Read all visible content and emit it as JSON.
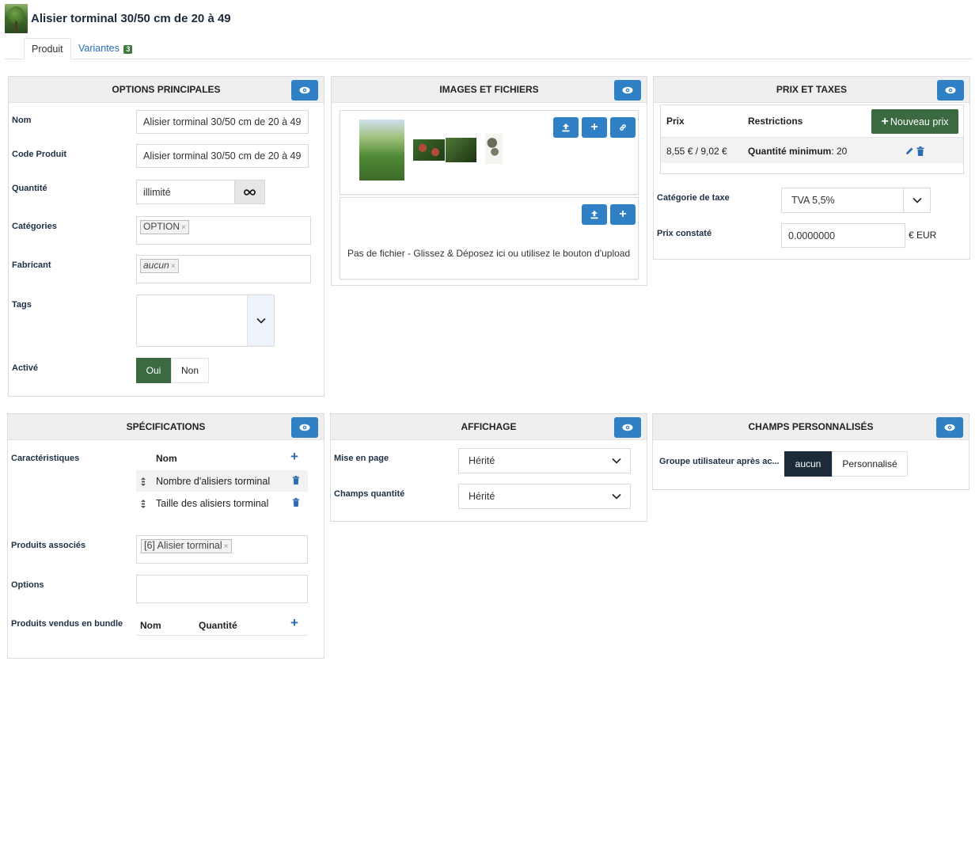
{
  "header": {
    "title": "Alisier torminal 30/50 cm de 20 à 49",
    "thumbnail_icon": "tree-thumbnail"
  },
  "tabs": [
    {
      "label": "Produit"
    },
    {
      "label": "Variantes",
      "badge": "3"
    }
  ],
  "options_principales": {
    "title": "OPTIONS PRINCIPALES",
    "nom_label": "Nom",
    "nom_value": "Alisier torminal 30/50 cm de 20 à 49",
    "code_label": "Code Produit",
    "code_value": "Alisier torminal 30/50 cm de 20 à 49",
    "quantite_label": "Quantité",
    "quantite_value": "illimité",
    "quantite_icon": "infinity-icon",
    "categories_label": "Catégories",
    "categories_tag": "OPTION",
    "fabricant_label": "Fabricant",
    "fabricant_tag": "aucun",
    "tags_label": "Tags",
    "active_label": "Activé",
    "active_on": "Oui",
    "active_off": "Non"
  },
  "images": {
    "title": "IMAGES ET FICHIERS",
    "no_file_text": "Pas de fichier - Glissez & Déposez ici ou utilisez le bouton d'upload"
  },
  "prix": {
    "title": "PRIX ET TAXES",
    "col_prix": "Prix",
    "col_restrictions": "Restrictions",
    "new_price_button": "Nouveau prix",
    "row_price": "8,55 € / 9,02 €",
    "row_restriction_label": "Quantité minimum",
    "row_restriction_value": ": 20",
    "taxe_label": "Catégorie de taxe",
    "taxe_value": "TVA 5,5%",
    "prix_constate_label": "Prix constaté",
    "prix_constate_value": "0.0000000",
    "currency": "€ EUR"
  },
  "specifications": {
    "title": "SPÉCIFICATIONS",
    "caracteristiques_label": "Caractéristiques",
    "col_nom": "Nom",
    "rows": [
      "Nombre d'alisiers torminal",
      "Taille des alisiers torminal"
    ],
    "produits_associes_label": "Produits associés",
    "produits_associes_tag": "[6] Alisier torminal",
    "options_label": "Options",
    "bundle_label": "Produits vendus en bundle",
    "bundle_col_nom": "Nom",
    "bundle_col_quantite": "Quantité"
  },
  "affichage": {
    "title": "AFFICHAGE",
    "mise_en_page_label": "Mise en page",
    "mise_en_page_value": "Hérité",
    "champs_quantite_label": "Champs quantité",
    "champs_quantite_value": "Hérité"
  },
  "champs_perso": {
    "title": "CHAMPS PERSONNALISÉS",
    "groupe_label": "Groupe utilisateur après ac...",
    "opt_on": "aucun",
    "opt_off": "Personnalisé"
  },
  "colors": {
    "accent_blue": "#2f80c4",
    "success_green": "#3b6a40",
    "dark_navy": "#1c2a3a"
  }
}
